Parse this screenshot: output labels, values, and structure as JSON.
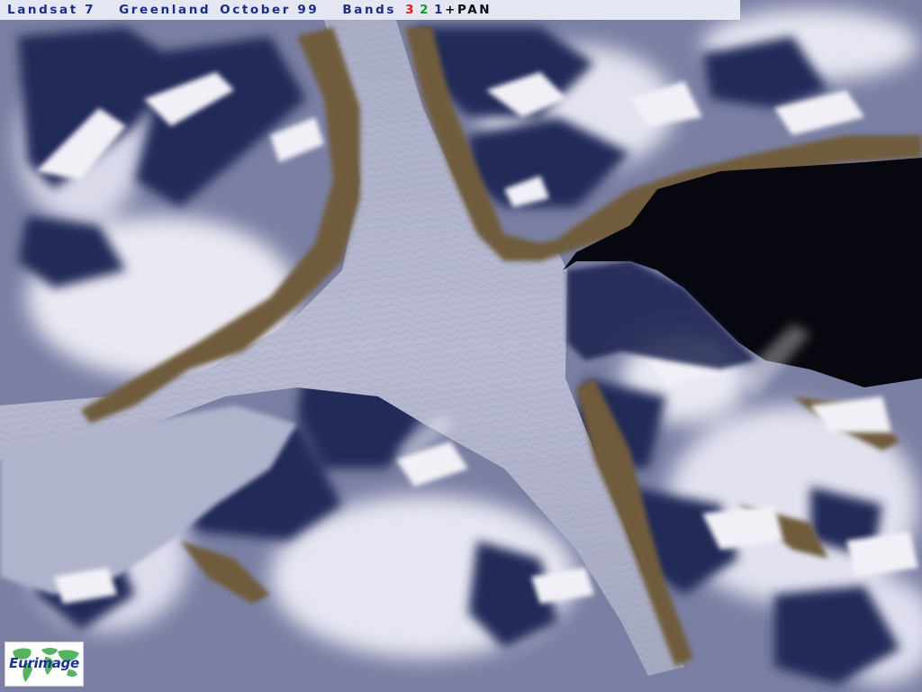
{
  "caption": {
    "satellite": "Landsat 7",
    "place": "Greenland",
    "date": "October 99",
    "bands_label": "Bands",
    "band_red": "3",
    "band_green": "2",
    "band_blue": "1",
    "plus": "+",
    "pan": "PAN"
  },
  "logo": {
    "text": "Eurimage"
  },
  "colors": {
    "caption_text": "#1b2c86",
    "band_red": "#e11818",
    "band_green": "#139a2a",
    "band_blue": "#1b2c86",
    "snow": "#e6e6f2",
    "shadow": "#1f2550",
    "glacier": "#b4b8d0",
    "rock": "#6b5a3a",
    "fjord_water": "#0a0b14"
  }
}
